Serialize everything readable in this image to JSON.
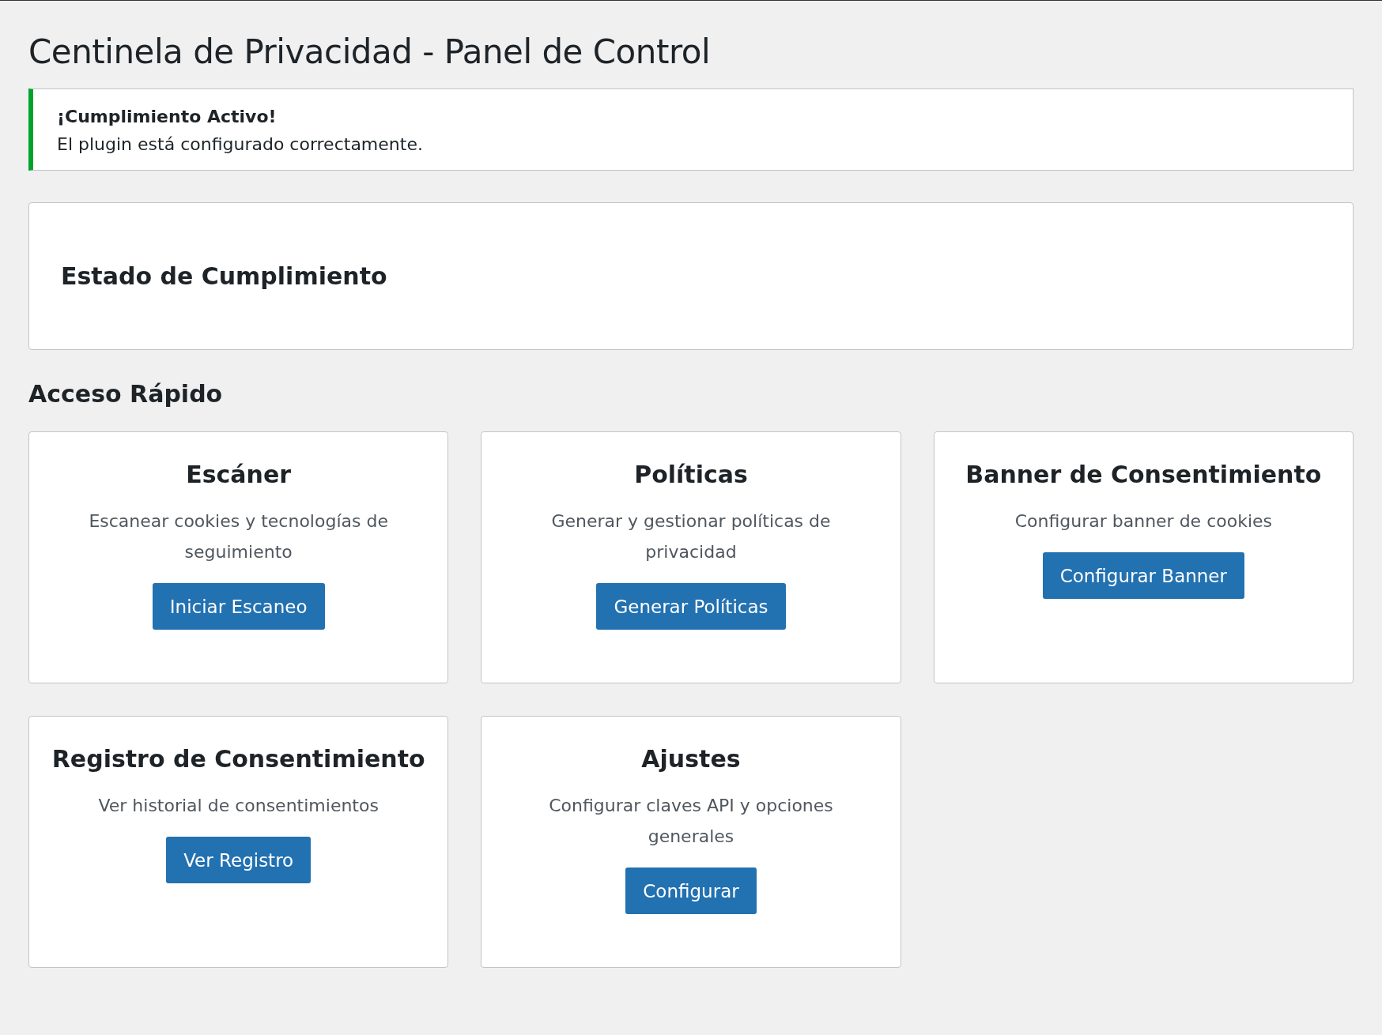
{
  "page": {
    "title": "Centinela de Privacidad - Panel de Control"
  },
  "notice": {
    "title": "¡Cumplimiento Activo!",
    "message": "El plugin está configurado correctamente."
  },
  "status_card": {
    "title": "Estado de Cumplimiento"
  },
  "quick_access": {
    "title": "Acceso Rápido",
    "cards": [
      {
        "title": "Escáner",
        "description": "Escanear cookies y tecnologías de seguimiento",
        "button": "Iniciar Escaneo"
      },
      {
        "title": "Políticas",
        "description": "Generar y gestionar políticas de privacidad",
        "button": "Generar Políticas"
      },
      {
        "title": "Banner de Consentimiento",
        "description": "Configurar banner de cookies",
        "button": "Configurar Banner"
      },
      {
        "title": "Registro de Consentimiento",
        "description": "Ver historial de consentimientos",
        "button": "Ver Registro"
      },
      {
        "title": "Ajustes",
        "description": "Configurar claves API y opciones generales",
        "button": "Configurar"
      }
    ]
  }
}
